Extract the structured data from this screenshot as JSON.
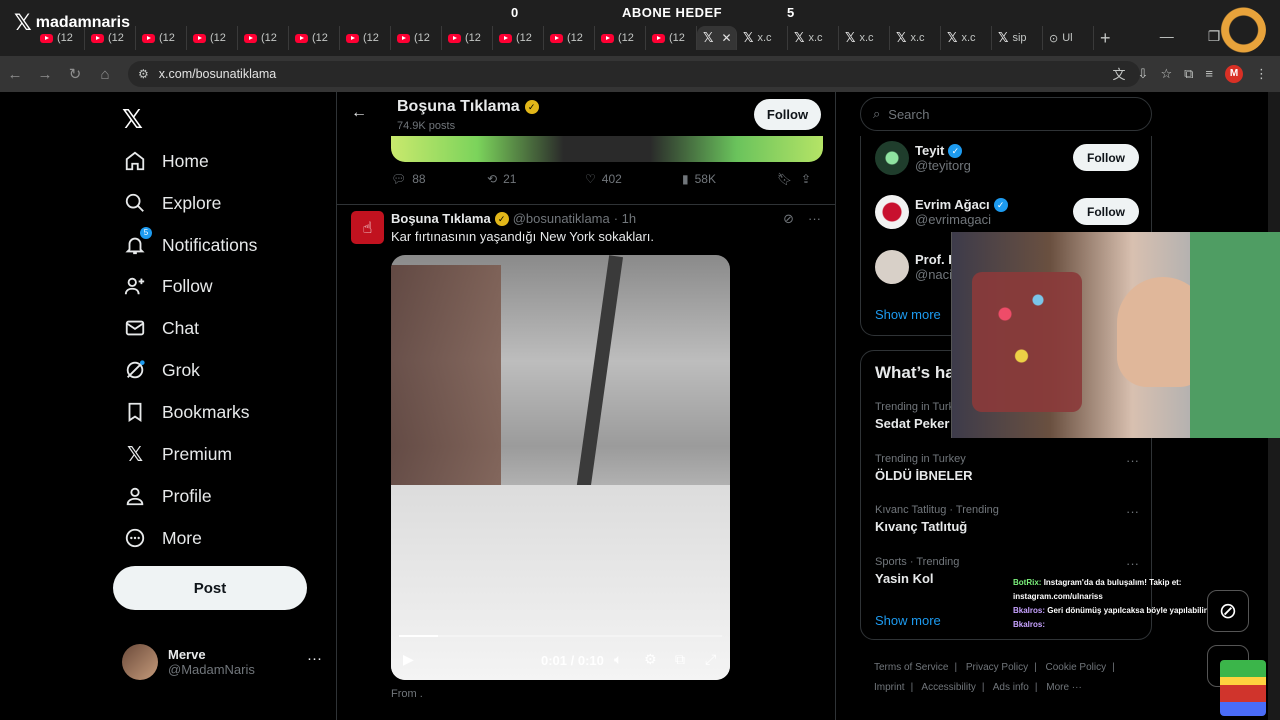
{
  "overlay": {
    "brand": "madamnaris",
    "left_number": "0",
    "goal_label": "ABONE HEDEF",
    "right_number": "5"
  },
  "browser": {
    "yt_tab_label": "(12",
    "x_tab_label": "x.c",
    "sip_tab_label": "sip",
    "ul_tab_label": "Ul",
    "url": "x.com/bosunatiklama",
    "profile_initial": "M"
  },
  "nav": {
    "home": "Home",
    "explore": "Explore",
    "notifications": "Notifications",
    "notifications_badge": "5",
    "follow": "Follow",
    "chat": "Chat",
    "grok": "Grok",
    "bookmarks": "Bookmarks",
    "premium": "Premium",
    "profile": "Profile",
    "more": "More",
    "post": "Post"
  },
  "account": {
    "name": "Merve",
    "handle": "@MadamNaris"
  },
  "header": {
    "name": "Boşuna Tıklama",
    "posts": "74.9K posts",
    "follow": "Follow"
  },
  "prev_tweet": {
    "replies": "88",
    "reposts": "21",
    "likes": "402",
    "views": "58K"
  },
  "tweet": {
    "author": "Boşuna Tıklama",
    "handle": "@bosunatiklama",
    "time": "· 1h",
    "text": "Kar fırtınasının yaşandığı New York sokakları.",
    "video_time": "0:01 / 0:10",
    "video_progress": 0.12,
    "from": "From ."
  },
  "right": {
    "search_placeholder": "Search",
    "who_to_follow": [
      {
        "name": "Teyit",
        "handle": "@teyitorg",
        "button": "Follow",
        "color": "#1f3d2c"
      },
      {
        "name": "Evrim Ağacı",
        "handle": "@evrimagaci",
        "button": "Follow",
        "color": "#f2f2f2"
      },
      {
        "name": "Prof. D",
        "handle": "@naci",
        "color": "#d8d0c8"
      }
    ],
    "show_more": "Show more",
    "trends_title": "What’s ha",
    "trends": [
      {
        "context": "Trending in Turk",
        "name": "Sedat Peker"
      },
      {
        "context": "Trending in Turkey",
        "name": "ÖLDÜ İBNELER"
      },
      {
        "context": "Kıvanc Tatlitug · Trending",
        "name": "Kıvanç Tatlıtuğ"
      },
      {
        "context": "Sports · Trending",
        "name": "Yasin Kol"
      }
    ],
    "show_more_trends": "Show more",
    "footer": [
      "Terms of Service",
      "|",
      "Privacy Policy",
      "|",
      "Cookie Policy",
      "|",
      "Imprint",
      "|",
      "Accessibility",
      "|",
      "Ads info",
      "|",
      "More ···"
    ]
  },
  "chat_overlay": [
    {
      "user": "BotRix:",
      "msg": "Instagram'da da buluşalım! Takip et: instagram.com/ulnariss"
    },
    {
      "user": "Bkalros:",
      "msg": "Geri dönümüş yapılcaksa böyle yapılabilinir y"
    },
    {
      "user": "Bkalros:",
      "msg": ""
    }
  ]
}
